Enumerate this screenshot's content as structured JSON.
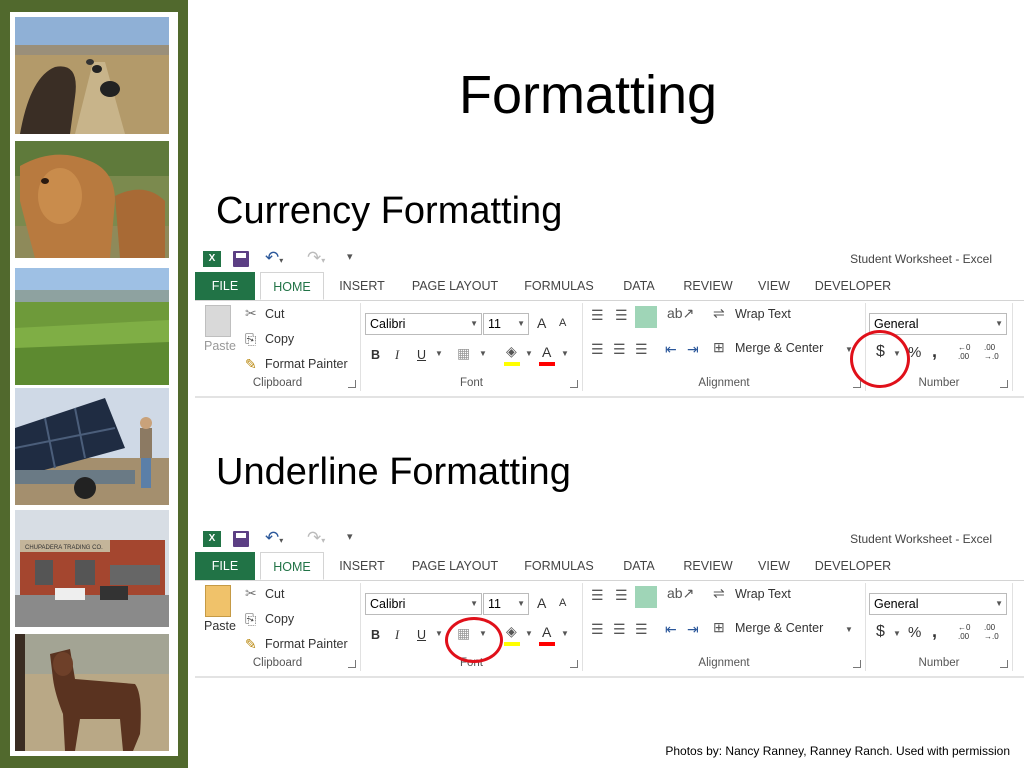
{
  "slide": {
    "title": "Formatting",
    "currency_heading": "Currency Formatting",
    "underline_heading": "Underline Formatting",
    "credit": "Photos by: Nancy Ranney,  Ranney Ranch. Used with permission"
  },
  "sidebar": {
    "photos": [
      "cattle-trail-photo",
      "cow-and-calf-photo",
      "grassland-photo",
      "solar-panel-truck-photo",
      "chupadera-trading-building-photo",
      "young-calf-photo"
    ],
    "storefront_sign": "CHUPADERA TRADING CO."
  },
  "ribbon": {
    "window_title": "Student Worksheet - Excel",
    "excel_icon_text": "X",
    "tabs": [
      "FILE",
      "HOME",
      "INSERT",
      "PAGE LAYOUT",
      "FORMULAS",
      "DATA",
      "REVIEW",
      "VIEW",
      "DEVELOPER"
    ],
    "clipboard": {
      "paste": "Paste",
      "cut": "Cut",
      "copy": "Copy",
      "format_painter": "Format Painter",
      "label": "Clipboard"
    },
    "font": {
      "name": "Calibri",
      "size": "11",
      "grow": "A",
      "shrink": "A",
      "bold": "B",
      "italic": "I",
      "underline": "U",
      "label": "Font"
    },
    "alignment": {
      "wrap_text": "Wrap Text",
      "merge_center": "Merge & Center",
      "label": "Alignment"
    },
    "number": {
      "format": "General",
      "currency": "$",
      "percent": "%",
      "comma": ",",
      "inc_top": "←0",
      "inc_bottom": ".00",
      "dec_top": ".00",
      "dec_bottom": "→.0",
      "label": "Number"
    }
  },
  "colors": {
    "sidebar": "#51692d",
    "excel_green": "#217346",
    "highlight_ring": "#e0101a",
    "fill_color": "#ffff00",
    "font_color": "#ff0000"
  }
}
